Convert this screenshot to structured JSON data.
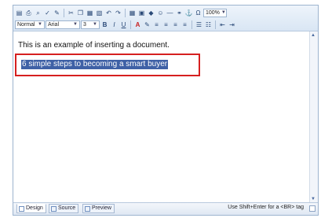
{
  "toolbar": {
    "format_select": "Normal",
    "font_select": "Arial",
    "size_select": "3",
    "zoom_select": "100%",
    "bold": "B",
    "italic": "I",
    "underline": "U",
    "font_color": "A",
    "omega": "Ω"
  },
  "content": {
    "line1": "This is an example of inserting a document.",
    "line2": "6 simple steps to becoming a smart buyer"
  },
  "tabs": [
    {
      "label": "Design"
    },
    {
      "label": "Source"
    },
    {
      "label": "Preview"
    }
  ],
  "status": {
    "hint": "Use Shift+Enter for a <BR> tag"
  },
  "colors": {
    "highlight_bg": "#3f61a6",
    "callout_border": "#d62020",
    "chrome": "#d9e6f4"
  }
}
